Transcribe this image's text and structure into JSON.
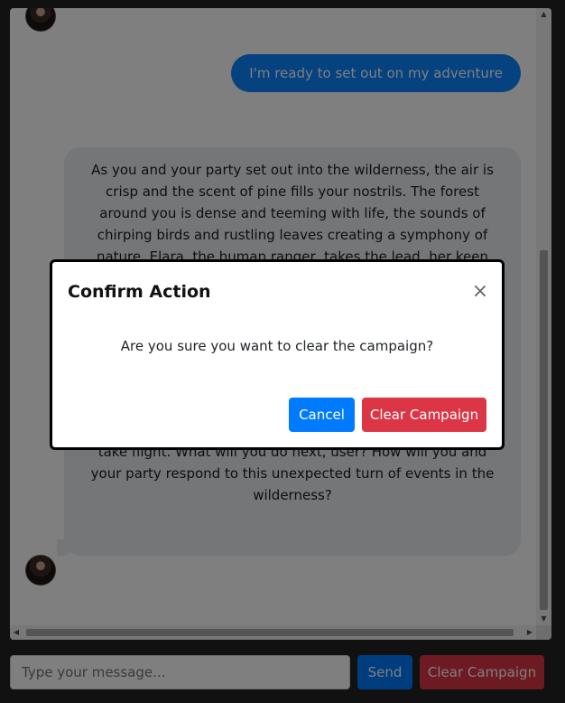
{
  "chat": {
    "user_message": "I'm ready to set out on my adventure",
    "ai_message": "As you and your party set out into the wilderness, the air is crisp and the scent of pine fills your nostrils. The forest around you is dense and teeming with life, the sounds of chirping birds and rustling leaves creating a symphony of nature. Elara, the human ranger, takes the lead, her keen eyes scanning the surroundings for any signs of danger. You follow the winding trail deeper into the woods until, suddenly, something catches the light among the roots of an ancient oak. Thorin kneels down and brushes away the soil, revealing a small, intricately carved amulet that seems to pulse with a faint enchantment. As he holds it up for everyone to see, a sudden tremor shakes the ground beneath your feet, causing the trees to sway and the birds to take flight. What will you do next, user? How will you and your party respond to this unexpected turn of events in the wilderness?"
  },
  "input": {
    "placeholder": "Type your message..."
  },
  "buttons": {
    "send": "Send",
    "clear_campaign": "Clear Campaign"
  },
  "modal": {
    "title": "Confirm Action",
    "close_glyph": "×",
    "body": "Are you sure you want to clear the campaign?",
    "cancel": "Cancel",
    "confirm": "Clear Campaign"
  },
  "scrollbar": {
    "up": "▲",
    "down": "▼",
    "left": "◀",
    "right": "▶"
  },
  "colors": {
    "primary": "#007bff",
    "danger": "#dc3545",
    "page_bg": "#222222",
    "ai_bubble": "#e9ecef",
    "user_bubble": "#0a84ff"
  }
}
